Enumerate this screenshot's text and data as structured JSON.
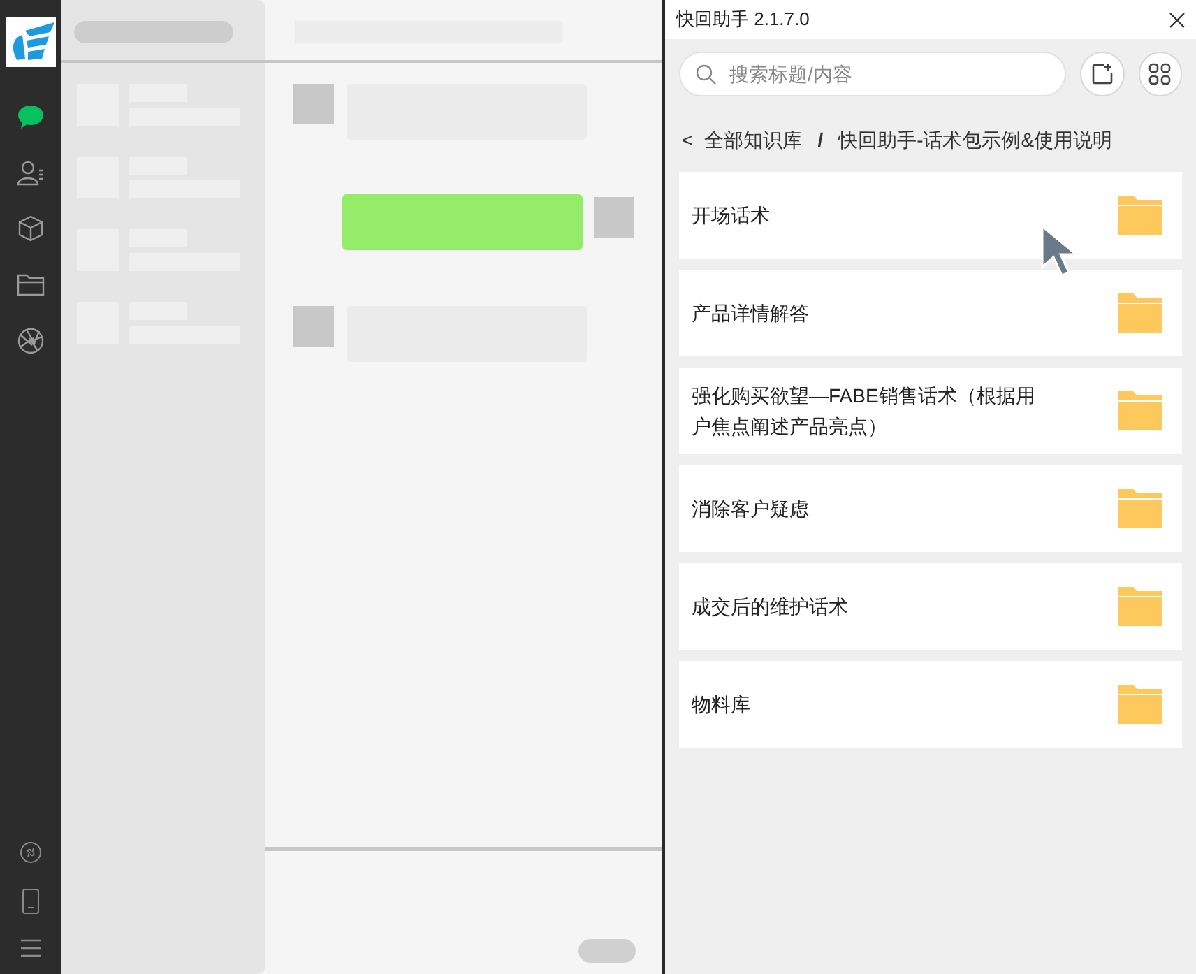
{
  "nav": [
    {
      "kind": "chat",
      "selected": true
    },
    {
      "kind": "contacts",
      "selected": false
    },
    {
      "kind": "box",
      "selected": false
    },
    {
      "kind": "folder",
      "selected": false
    },
    {
      "kind": "aperture",
      "selected": false
    }
  ],
  "panel": {
    "title": "快回助手 2.1.7.0",
    "search": {
      "placeholder": "搜索标题/内容"
    },
    "breadcrumb": {
      "back": "<",
      "root": "全部知识库",
      "separator": "/",
      "current": "快回助手-话术包示例&使用说明"
    },
    "folders": [
      {
        "label": "开场话术"
      },
      {
        "label": "产品详情解答"
      },
      {
        "label": "强化购买欲望—FABE销售话术（根据用户焦点阐述产品亮点）"
      },
      {
        "label": "消除客户疑虑"
      },
      {
        "label": "成交后的维护话术"
      },
      {
        "label": "物料库"
      }
    ]
  }
}
